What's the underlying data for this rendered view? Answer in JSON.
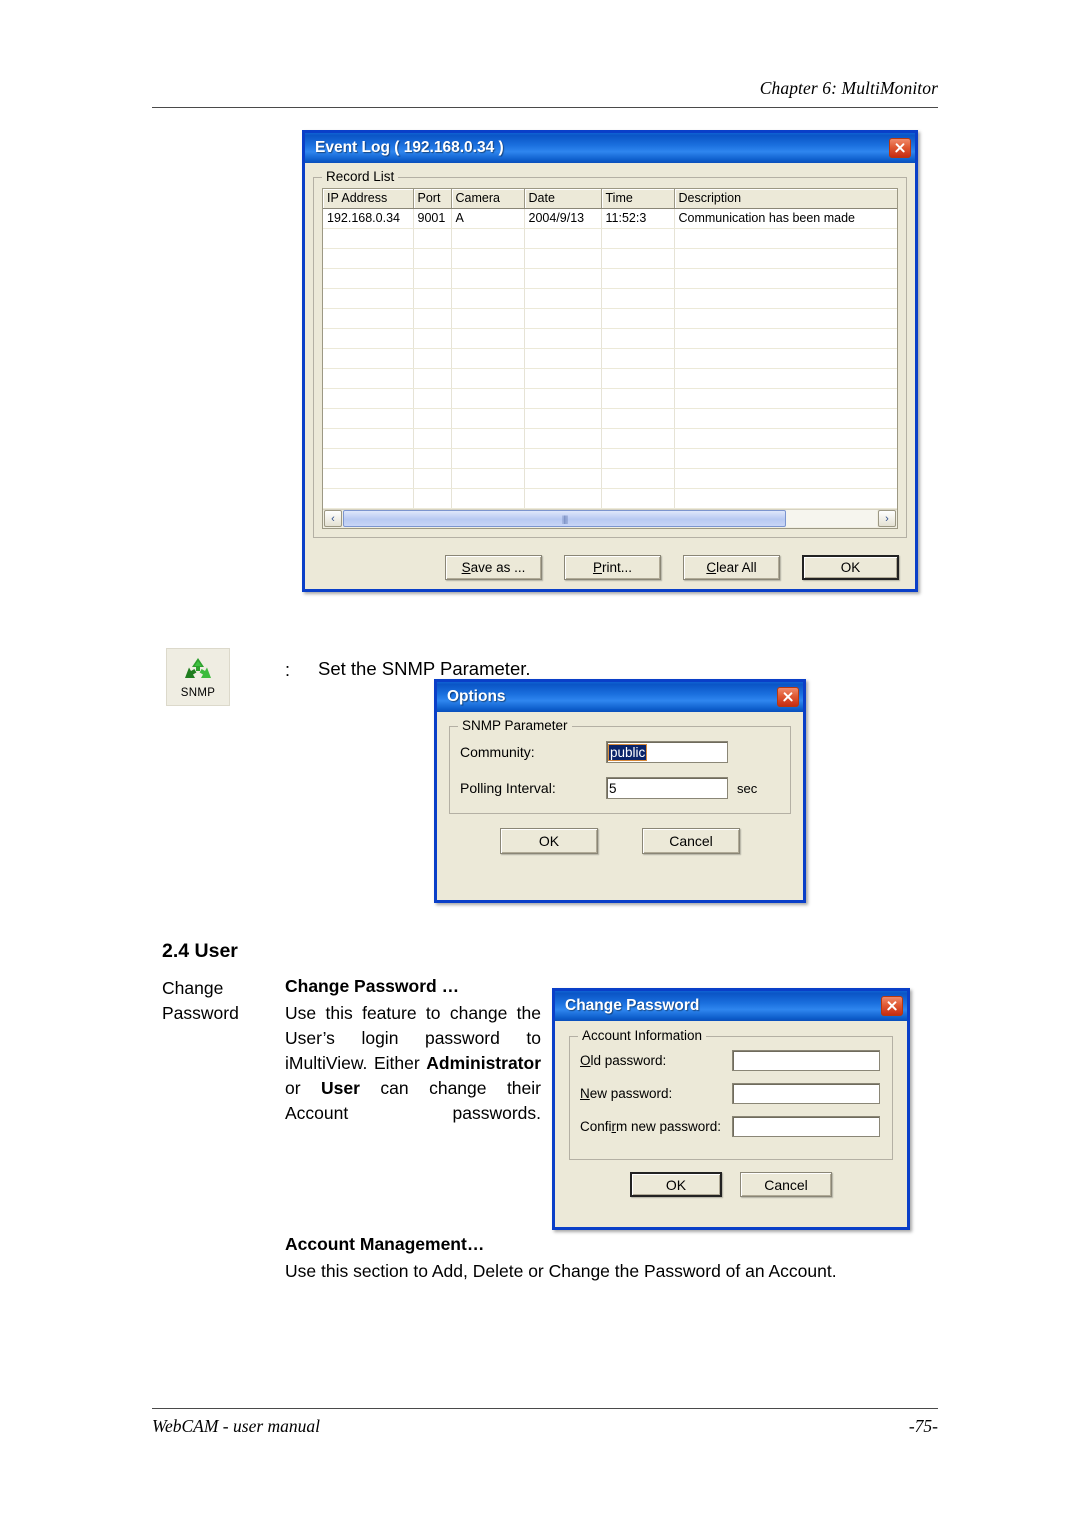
{
  "header": {
    "chapter": "Chapter 6: MultiMonitor"
  },
  "footer": {
    "manual": "WebCAM - user manual",
    "page": "-75-"
  },
  "event_log_dialog": {
    "title": "Event Log ( 192.168.0.34 )",
    "group_legend": "Record List",
    "columns": [
      "IP Address",
      "Port",
      "Camera",
      "Date",
      "Time",
      "Description"
    ],
    "rows": [
      [
        "192.168.0.34",
        "9001",
        "A",
        "2004/9/13",
        "11:52:3",
        "Communication has been made"
      ]
    ],
    "empty_row_count": 14,
    "scrollbar": {
      "left_arrow": "‹",
      "right_arrow": "›",
      "grip": "||||"
    },
    "buttons": [
      {
        "name": "save-as-button",
        "pre": "S",
        "post": "ave as ...",
        "default": false
      },
      {
        "name": "print-button",
        "pre": "P",
        "post": "rint...",
        "default": false
      },
      {
        "name": "clear-all-button",
        "pre": "C",
        "post": "lear All",
        "default": false
      },
      {
        "name": "ok-button",
        "pre": "",
        "post": "OK",
        "default": true
      }
    ],
    "close_label": "Close"
  },
  "snmp_note": {
    "icon_caption": "SNMP",
    "separator": ":",
    "description": "Set the SNMP Parameter."
  },
  "options_dialog": {
    "title": "Options",
    "group_legend": "SNMP Parameter",
    "fields": [
      {
        "label": "Community:",
        "value": "public",
        "selected": true,
        "unit": ""
      },
      {
        "label": "Polling Interval:",
        "value": "5",
        "selected": false,
        "unit": "sec"
      }
    ],
    "buttons": [
      {
        "name": "ok-button",
        "label": "OK",
        "default": false
      },
      {
        "name": "cancel-button",
        "label": "Cancel",
        "default": false
      }
    ]
  },
  "section": {
    "number_title": "2.4 User",
    "side_label": "Change Password",
    "subhead": "Change Password …",
    "body_parts": [
      {
        "text": "Use this feature to change the User’s login password to iMultiView. Either ",
        "bold": false
      },
      {
        "text": "Administrator",
        "bold": true
      },
      {
        "text": " or ",
        "bold": false
      },
      {
        "text": "User",
        "bold": true
      },
      {
        "text": " can change their Account passwords.",
        "bold": false
      }
    ],
    "body_plain": "Use this feature to change the User’s login password to iMultiView. Either Administrator or User can change their Account passwords."
  },
  "change_password_dialog": {
    "title": "Change Password",
    "group_legend": "Account Information",
    "fields": [
      {
        "pre": "O",
        "acc": "ld password:",
        "value": ""
      },
      {
        "pre": "N",
        "acc": "ew password:",
        "value": ""
      },
      {
        "pre": "Confi",
        "acc": "rm new password:",
        "value": ""
      }
    ],
    "buttons": [
      {
        "name": "ok-button",
        "label": "OK",
        "default": true
      },
      {
        "name": "cancel-button",
        "label": "Cancel",
        "default": false
      }
    ]
  },
  "account_management": {
    "subhead": "Account Management…",
    "body": "Use this section to Add, Delete or Change the Password of an Account."
  },
  "colors": {
    "title_bar_blue": "#0a55c6",
    "dialog_face": "#ece9d8",
    "dialog_border": "#0a3fc8",
    "selection_blue": "#0a246a",
    "close_red": "#c62c12",
    "snmp_green": "#2ea02e"
  }
}
